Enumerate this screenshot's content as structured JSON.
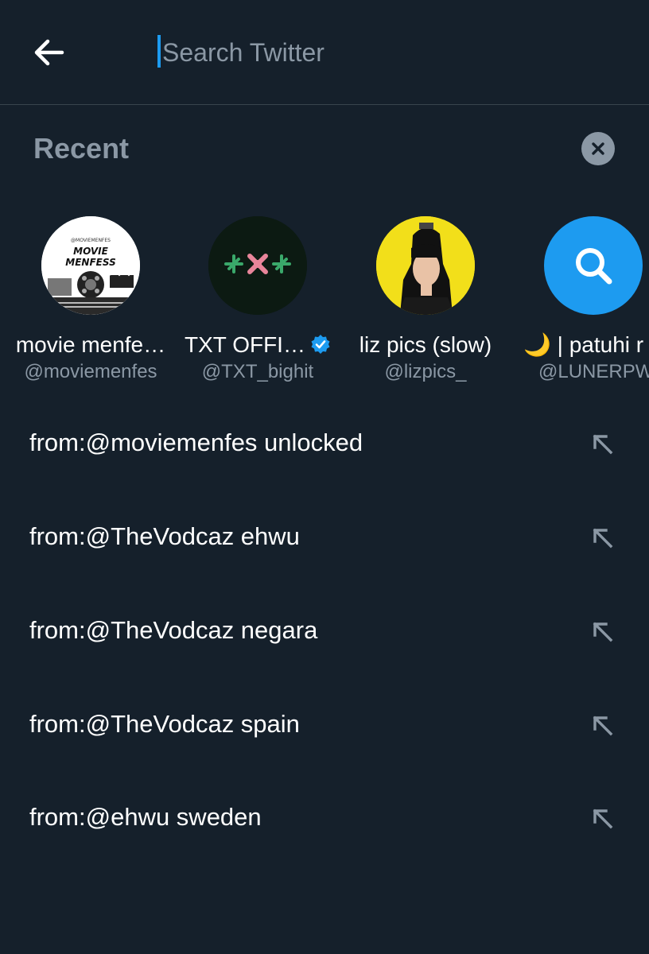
{
  "search": {
    "placeholder": "Search Twitter",
    "value": ""
  },
  "recent": {
    "title": "Recent",
    "clear_icon": "close-icon"
  },
  "accounts": [
    {
      "name": "movie menfe…",
      "handle": "@moviemenfes",
      "avatar_text": "MOVIE MENFESS",
      "verified": false
    },
    {
      "name": "TXT OFFI…",
      "handle": "@TXT_bighit",
      "avatar_text": "",
      "verified": true
    },
    {
      "name": "liz pics (slow)",
      "handle": "@lizpics_",
      "avatar_text": "",
      "verified": false
    },
    {
      "name": "🌙 | patuhi r",
      "handle": "@LUNERPW",
      "avatar_text": "",
      "verified": false,
      "avatar_icon": "search-icon"
    }
  ],
  "queries": [
    {
      "text": "from:@moviemenfes unlocked"
    },
    {
      "text": "from:@TheVodcaz ehwu"
    },
    {
      "text": "from:@TheVodcaz negara"
    },
    {
      "text": "from:@TheVodcaz spain"
    },
    {
      "text": "from:@ehwu sweden"
    }
  ],
  "colors": {
    "background": "#15202b",
    "accent": "#1d9bf0",
    "secondary_text": "#8b98a5",
    "divider": "#38444d"
  }
}
